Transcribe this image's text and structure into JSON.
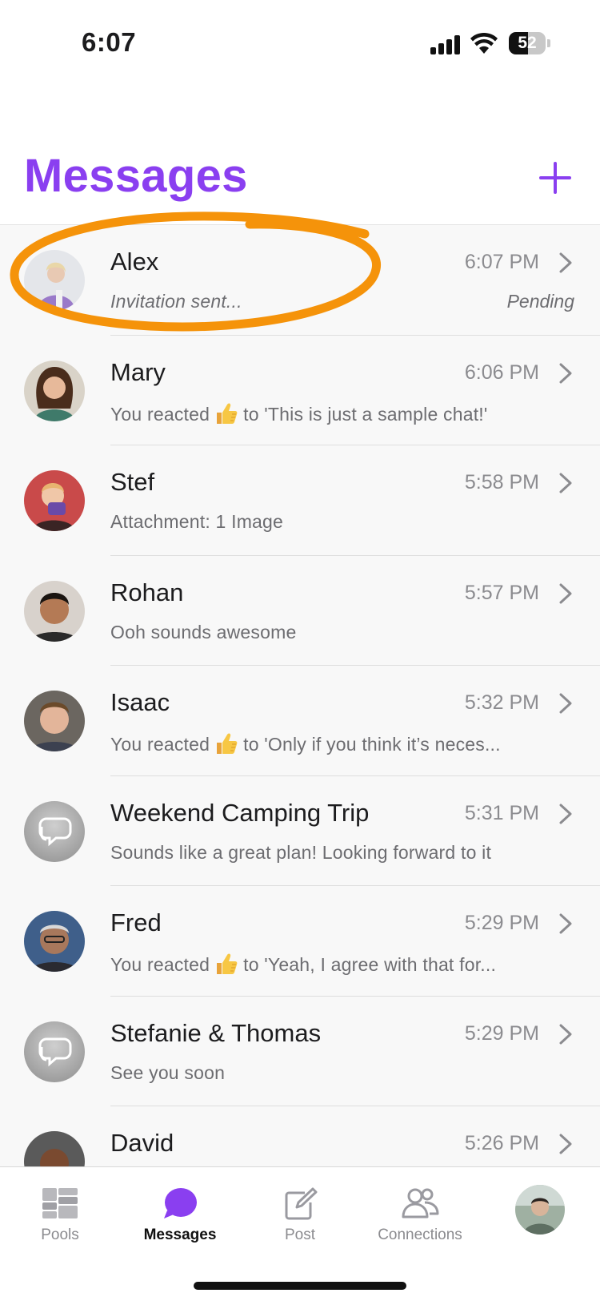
{
  "status_bar": {
    "time": "6:07",
    "battery": "52",
    "battery_level": 0.52
  },
  "header": {
    "title": "Messages",
    "add_icon": "plus-icon"
  },
  "conversations": [
    {
      "name": "Alex",
      "time": "6:07 PM",
      "preview": "Invitation sent...",
      "status": "Pending",
      "avatar": "photo"
    },
    {
      "name": "Mary",
      "time": "6:06 PM",
      "preview_before": "You reacted",
      "emoji": "thumbs-up",
      "preview_after": "to 'This is just a sample chat!'",
      "avatar": "photo"
    },
    {
      "name": "Stef",
      "time": "5:58 PM",
      "preview": "Attachment: 1 Image",
      "avatar": "photo"
    },
    {
      "name": "Rohan",
      "time": "5:57 PM",
      "preview": "Ooh sounds awesome",
      "avatar": "photo"
    },
    {
      "name": "Isaac",
      "time": "5:32 PM",
      "preview_before": "You reacted",
      "emoji": "thumbs-up",
      "preview_after": "to 'Only if you think it’s neces...",
      "avatar": "photo"
    },
    {
      "name": "Weekend Camping Trip",
      "time": "5:31 PM",
      "preview": "Sounds like a great plan! Looking forward to it",
      "avatar": "group-chat-icon"
    },
    {
      "name": "Fred",
      "time": "5:29 PM",
      "preview_before": "You reacted",
      "emoji": "thumbs-up",
      "preview_after": "to 'Yeah, I agree with that for...",
      "avatar": "photo"
    },
    {
      "name": "Stefanie & Thomas",
      "time": "5:29 PM",
      "preview": "See you soon",
      "avatar": "group-chat-icon"
    },
    {
      "name": "David",
      "time": "5:26 PM",
      "preview": "",
      "avatar": "photo"
    }
  ],
  "tabs": [
    {
      "label": "Pools",
      "icon": "pools-grid-icon",
      "active": false
    },
    {
      "label": "Messages",
      "icon": "chat-bubble-icon",
      "active": true
    },
    {
      "label": "Post",
      "icon": "compose-icon",
      "active": false
    },
    {
      "label": "Connections",
      "icon": "people-icon",
      "active": false
    },
    {
      "label": "",
      "icon": "profile-avatar",
      "active": false
    }
  ],
  "colors": {
    "accent": "#8a3ff0",
    "highlight": "#f5930a",
    "list_background": "#f8f8f8"
  }
}
